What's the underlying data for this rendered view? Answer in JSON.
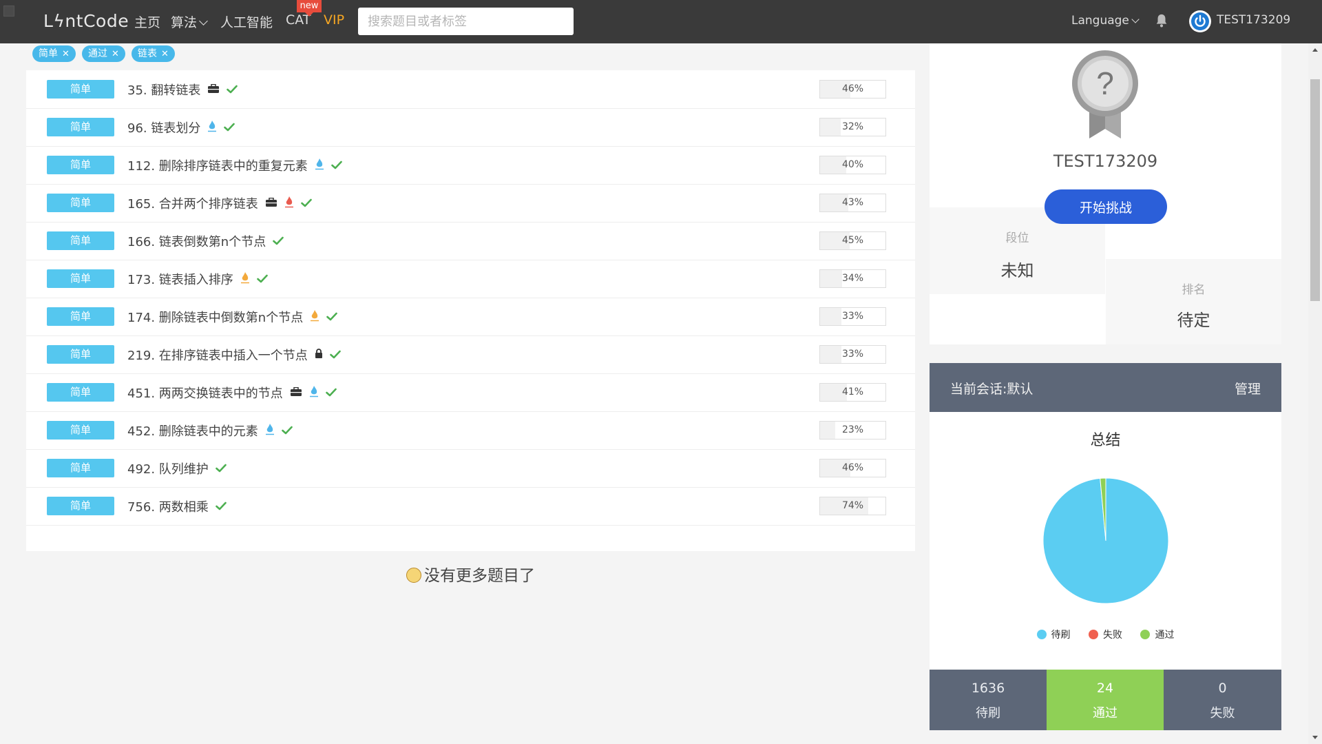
{
  "nav": {
    "logo": "LϟntCode",
    "home": "主页",
    "algorithm": "算法",
    "ai": "人工智能",
    "cat": "CAT",
    "cat_badge": "new",
    "vip": "VIP",
    "search_placeholder": "搜索题目或者标签",
    "language": "Language",
    "username": "TEST173209"
  },
  "filters": [
    {
      "label": "简单"
    },
    {
      "label": "通过"
    },
    {
      "label": "链表"
    }
  ],
  "problems": [
    {
      "level": "简单",
      "title": "35. 翻转链表",
      "icons": [
        "briefcase-icon",
        "check-icon"
      ],
      "rate": "46%",
      "rate_value": 46
    },
    {
      "level": "简单",
      "title": "96. 链表划分",
      "icons": [
        "flame-blue-icon",
        "check-icon"
      ],
      "rate": "32%",
      "rate_value": 32
    },
    {
      "level": "简单",
      "title": "112. 删除排序链表中的重复元素",
      "icons": [
        "flame-blue-icon",
        "check-icon"
      ],
      "rate": "40%",
      "rate_value": 40
    },
    {
      "level": "简单",
      "title": "165. 合并两个排序链表",
      "icons": [
        "briefcase-icon",
        "flame-red-icon",
        "check-icon"
      ],
      "rate": "43%",
      "rate_value": 43
    },
    {
      "level": "简单",
      "title": "166. 链表倒数第n个节点",
      "icons": [
        "check-icon"
      ],
      "rate": "45%",
      "rate_value": 45
    },
    {
      "level": "简单",
      "title": "173. 链表插入排序",
      "icons": [
        "flame-orange-icon",
        "check-icon"
      ],
      "rate": "34%",
      "rate_value": 34
    },
    {
      "level": "简单",
      "title": "174. 删除链表中倒数第n个节点",
      "icons": [
        "flame-orange-icon",
        "check-icon"
      ],
      "rate": "33%",
      "rate_value": 33
    },
    {
      "level": "简单",
      "title": "219. 在排序链表中插入一个节点",
      "icons": [
        "lock-icon",
        "check-icon"
      ],
      "rate": "33%",
      "rate_value": 33
    },
    {
      "level": "简单",
      "title": "451. 两两交换链表中的节点",
      "icons": [
        "briefcase-icon",
        "flame-blue-icon",
        "check-icon"
      ],
      "rate": "41%",
      "rate_value": 41
    },
    {
      "level": "简单",
      "title": "452. 删除链表中的元素",
      "icons": [
        "flame-blue-icon",
        "check-icon"
      ],
      "rate": "23%",
      "rate_value": 23
    },
    {
      "level": "简单",
      "title": "492. 队列维护",
      "icons": [
        "check-icon"
      ],
      "rate": "46%",
      "rate_value": 46
    },
    {
      "level": "简单",
      "title": "756. 两数相乘",
      "icons": [
        "check-icon"
      ],
      "rate": "74%",
      "rate_value": 74
    }
  ],
  "no_more": "没有更多题目了",
  "profile": {
    "name": "TEST173209",
    "challenge_button": "开始挑战",
    "tier_label": "段位",
    "tier_value": "未知",
    "rank_label": "排名",
    "rank_value": "待定"
  },
  "summary": {
    "session": "当前会话:默认",
    "manage": "管理",
    "title": "总结",
    "legend": [
      {
        "label": "待刷",
        "color": "#5bcdf2"
      },
      {
        "label": "失败",
        "color": "#f0604f"
      },
      {
        "label": "通过",
        "color": "#8fd056"
      }
    ],
    "stats": [
      {
        "value": "1636",
        "label": "待刷",
        "bg": "#5d6778"
      },
      {
        "value": "24",
        "label": "通过",
        "bg": "#8fd056"
      },
      {
        "value": "0",
        "label": "失败",
        "bg": "#5d6778"
      }
    ]
  },
  "chart_data": {
    "type": "pie",
    "categories": [
      "待刷",
      "失败",
      "通过"
    ],
    "values": [
      1636,
      0,
      24
    ],
    "colors": [
      "#5bcdf2",
      "#f0604f",
      "#8fd056"
    ],
    "title": "总结"
  },
  "colors": {
    "nav_bg": "#3a3a3a",
    "level_badge": "#55c7ef",
    "accent_blue": "#2b5fd9",
    "check_green": "#4caf50",
    "summary_header": "#5d6778"
  }
}
